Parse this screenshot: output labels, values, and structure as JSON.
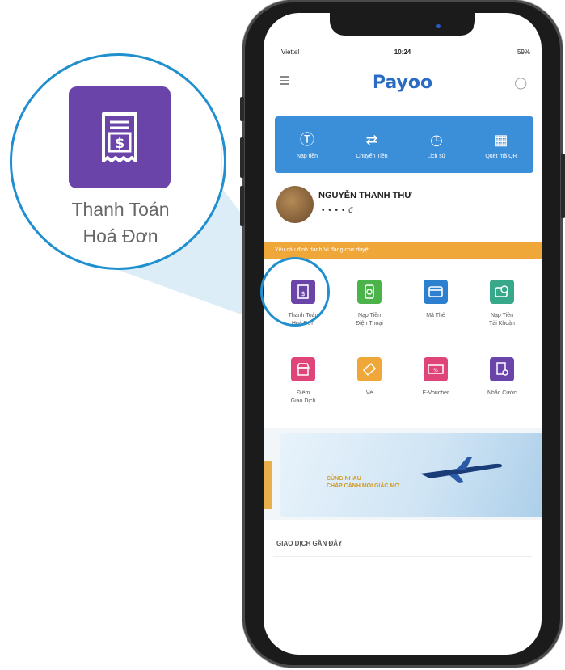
{
  "zoom": {
    "label_line1": "Thanh Toán",
    "label_line2": "Hoá Đơn",
    "icon_color": "#6a44a8"
  },
  "status_bar": {
    "carrier": "Viettel",
    "time": "10:24",
    "battery": "59%"
  },
  "header": {
    "logo": "Payoo"
  },
  "quick_actions": [
    {
      "label": "Nạp tiền",
      "icon": "dollar-plus-icon"
    },
    {
      "label": "Chuyển Tiền",
      "icon": "transfer-icon"
    },
    {
      "label": "Lịch sử",
      "icon": "history-icon"
    },
    {
      "label": "Quét mã QR",
      "icon": "qr-icon"
    }
  ],
  "user": {
    "name": "NGUYỄN THANH THƯ",
    "balance": "• • • • đ"
  },
  "notice": {
    "text": "Yêu cầu định danh Ví đang chờ duyệt"
  },
  "services": [
    {
      "line1": "Thanh Toán",
      "line2": "Hoá Đơn",
      "color": "#6a44a8",
      "icon": "bill-icon"
    },
    {
      "line1": "Nạp Tiền",
      "line2": "Điện Thoại",
      "color": "#4cb24a",
      "icon": "phone-topup-icon"
    },
    {
      "line1": "Mã Thẻ",
      "line2": "",
      "color": "#2d7fd0",
      "icon": "card-code-icon"
    },
    {
      "line1": "Nạp Tiền",
      "line2": "Tài Khoản",
      "color": "#37a88a",
      "icon": "account-topup-icon"
    },
    {
      "line1": "Điểm",
      "line2": "Giao Dịch",
      "color": "#e0457a",
      "icon": "store-icon"
    },
    {
      "line1": "Vé",
      "line2": "",
      "color": "#efa73a",
      "icon": "ticket-icon"
    },
    {
      "line1": "E-Voucher",
      "line2": "",
      "color": "#e0457a",
      "icon": "voucher-icon"
    },
    {
      "line1": "Nhắc Cước",
      "line2": "",
      "color": "#6a44a8",
      "icon": "reminder-icon"
    }
  ],
  "promo": {
    "line1": "CÙNG NHAU",
    "line2": "CHẮP CÁNH MỌI GIẤC MƠ"
  },
  "recent": {
    "title": "GIAO DỊCH GẦN ĐÂY"
  }
}
